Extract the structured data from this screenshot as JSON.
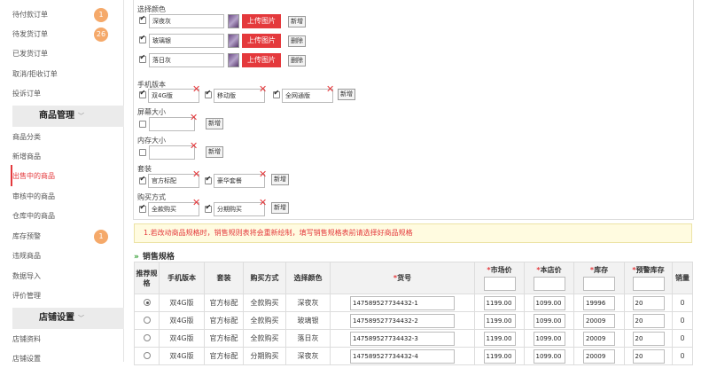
{
  "sidebar": {
    "orders": [
      {
        "label": "待付款订单",
        "badge": "1"
      },
      {
        "label": "待发货订单",
        "badge": "26"
      },
      {
        "label": "已发货订单",
        "badge": ""
      },
      {
        "label": "取消/拒收订单",
        "badge": ""
      },
      {
        "label": "投诉订单",
        "badge": ""
      }
    ],
    "goods_header": "商品管理",
    "goods": [
      {
        "label": "商品分类",
        "badge": ""
      },
      {
        "label": "新增商品",
        "badge": ""
      },
      {
        "label": "出售中的商品",
        "badge": ""
      },
      {
        "label": "审核中的商品",
        "badge": ""
      },
      {
        "label": "仓库中的商品",
        "badge": ""
      },
      {
        "label": "库存预警",
        "badge": "1"
      },
      {
        "label": "违规商品",
        "badge": ""
      },
      {
        "label": "数据导入",
        "badge": ""
      },
      {
        "label": "评价管理",
        "badge": ""
      }
    ],
    "shop_header": "店铺设置",
    "shop": [
      {
        "label": "店铺资料",
        "badge": ""
      },
      {
        "label": "店铺设置",
        "badge": ""
      }
    ]
  },
  "form": {
    "color_label": "选择颜色",
    "colors": [
      "深夜灰",
      "玻璃银",
      "落日灰"
    ],
    "upload_label": "上传图片",
    "add_label": "新增",
    "delete_label": "删除",
    "version_label": "手机版本",
    "versions": [
      "双4G版",
      "移动版",
      "全网通版"
    ],
    "screen_label": "屏幕大小",
    "memory_label": "内存大小",
    "package_label": "套装",
    "packages": [
      "官方标配",
      "豪华套餐"
    ],
    "purchase_label": "购买方式",
    "purchases": [
      "全款购买",
      "分期购买"
    ]
  },
  "notice": "1.若改动商品规格时，销售规则表将会重新绘制，填写销售规格表前请选择好商品规格",
  "spec_title": "销售规格",
  "table": {
    "headers": [
      "推荐规格",
      "手机版本",
      "套装",
      "购买方式",
      "选择颜色",
      "货号",
      "市场价",
      "本店价",
      "库存",
      "预警库存",
      "销量"
    ],
    "rows": [
      {
        "version": "双4G版",
        "package": "官方标配",
        "purchase": "全款购买",
        "color": "深夜灰",
        "sku": "147589527734432-1",
        "market": "1199.00",
        "price": "1099.00",
        "stock": "19996",
        "warn": "20",
        "sales": "0"
      },
      {
        "version": "双4G版",
        "package": "官方标配",
        "purchase": "全款购买",
        "color": "玻璃银",
        "sku": "147589527734432-2",
        "market": "1199.00",
        "price": "1099.00",
        "stock": "20009",
        "warn": "20",
        "sales": "0"
      },
      {
        "version": "双4G版",
        "package": "官方标配",
        "purchase": "全款购买",
        "color": "落日灰",
        "sku": "147589527734432-3",
        "market": "1199.00",
        "price": "1099.00",
        "stock": "20009",
        "warn": "20",
        "sales": "0"
      },
      {
        "version": "双4G版",
        "package": "官方标配",
        "purchase": "分期购买",
        "color": "深夜灰",
        "sku": "147589527734432-4",
        "market": "1199.00",
        "price": "1099.00",
        "stock": "20009",
        "warn": "20",
        "sales": "0"
      }
    ]
  }
}
